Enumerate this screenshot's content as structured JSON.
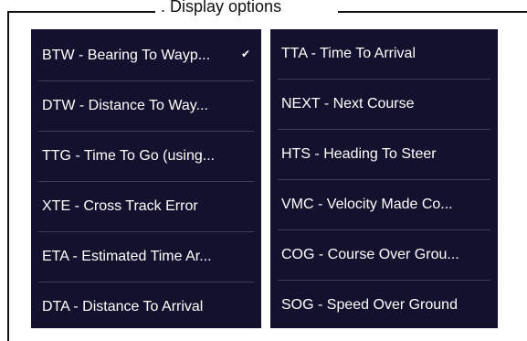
{
  "frame": {
    "title": ". Display options"
  },
  "left_list": [
    {
      "label": "BTW - Bearing To Wayp...",
      "checked": true
    },
    {
      "label": "DTW - Distance To Way..."
    },
    {
      "label": "TTG - Time To Go (using..."
    },
    {
      "label": "XTE - Cross Track Error"
    },
    {
      "label": "ETA - Estimated Time Ar..."
    },
    {
      "label": "DTA - Distance To Arrival"
    }
  ],
  "right_list": [
    {
      "label": "TTA - Time To Arrival"
    },
    {
      "label": "NEXT - Next Course"
    },
    {
      "label": "HTS - Heading To Steer"
    },
    {
      "label": "VMC - Velocity Made Co..."
    },
    {
      "label": "COG - Course Over Grou..."
    },
    {
      "label": "SOG - Speed Over Ground"
    }
  ],
  "check_glyph": "✔",
  "colors": {
    "panel_bg": "#14112e",
    "text": "#ffffff",
    "divider": "#3b3f5c"
  }
}
